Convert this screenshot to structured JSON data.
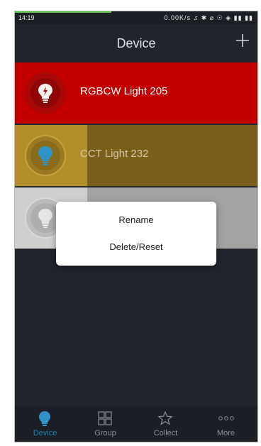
{
  "status_bar": {
    "time": "14:19",
    "right_text": "0.00K/s ♫ ✱ ⌀ ☉ ◈ ▮▮ ▮▮"
  },
  "header": {
    "title": "Device",
    "add_icon": "plus-icon"
  },
  "devices": [
    {
      "name": "RGBCW Light 205",
      "icon": "bulb-lightning-icon",
      "color": "#c30000"
    },
    {
      "name": "CCT Light 232",
      "icon": "bulb-icon",
      "color": "#b38f2b"
    },
    {
      "name": "",
      "icon": "bulb-icon",
      "color": "#cfcfcf"
    }
  ],
  "context_menu": {
    "items": [
      {
        "label": "Rename"
      },
      {
        "label": "Delete/Reset"
      }
    ]
  },
  "tabs": [
    {
      "label": "Device",
      "icon": "bulb-icon",
      "active": true
    },
    {
      "label": "Group",
      "icon": "grid-icon",
      "active": false
    },
    {
      "label": "Collect",
      "icon": "star-icon",
      "active": false
    },
    {
      "label": "More",
      "icon": "more-dots-icon",
      "active": false
    }
  ],
  "colors": {
    "accent": "#1f7fb5",
    "background": "#20252c"
  }
}
